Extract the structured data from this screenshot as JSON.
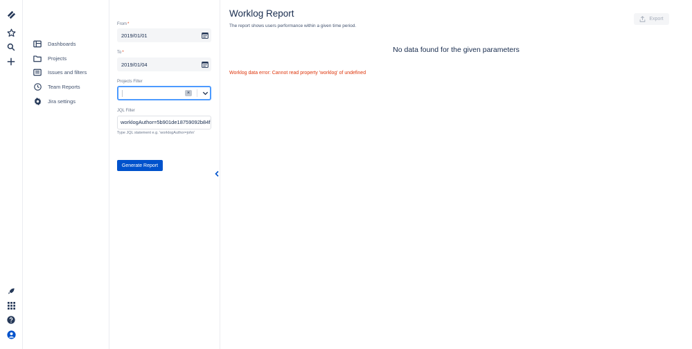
{
  "rail": {
    "icons": [
      "jira-logo-icon",
      "star-icon",
      "search-icon",
      "plus-icon",
      "rocket-icon",
      "app-switcher-icon",
      "help-icon",
      "profile-icon"
    ]
  },
  "sidebar": {
    "items": [
      {
        "label": "Dashboards",
        "icon": "dashboard-icon"
      },
      {
        "label": "Projects",
        "icon": "folder-icon"
      },
      {
        "label": "Issues and filters",
        "icon": "issues-icon"
      },
      {
        "label": "Team Reports",
        "icon": "clock-icon"
      },
      {
        "label": "Jira settings",
        "icon": "gear-icon"
      }
    ]
  },
  "form": {
    "from_label": "From",
    "from_value": "2019/01/01",
    "to_label": "To",
    "to_value": "2019/01/04",
    "required_mark": "*",
    "projects_label": "Projects Filter",
    "projects_clear": "×",
    "jql_label": "JQL Filter",
    "jql_value": "worklogAuthor=5b901de18759092b84f",
    "jql_hint": "Type JQL statement e.g. 'worklogAuthor=john'",
    "generate_label": "Generate Report"
  },
  "main": {
    "title": "Worklog Report",
    "subtitle": "The report shows users performance within a given time period.",
    "export_label": "Export",
    "no_data": "No data found for the given parameters",
    "error": "Worklog data error: Cannot read property 'worklog' of undefined"
  },
  "colors": {
    "primary": "#0052cc",
    "error": "#de350b",
    "focus": "#4c9aff"
  }
}
